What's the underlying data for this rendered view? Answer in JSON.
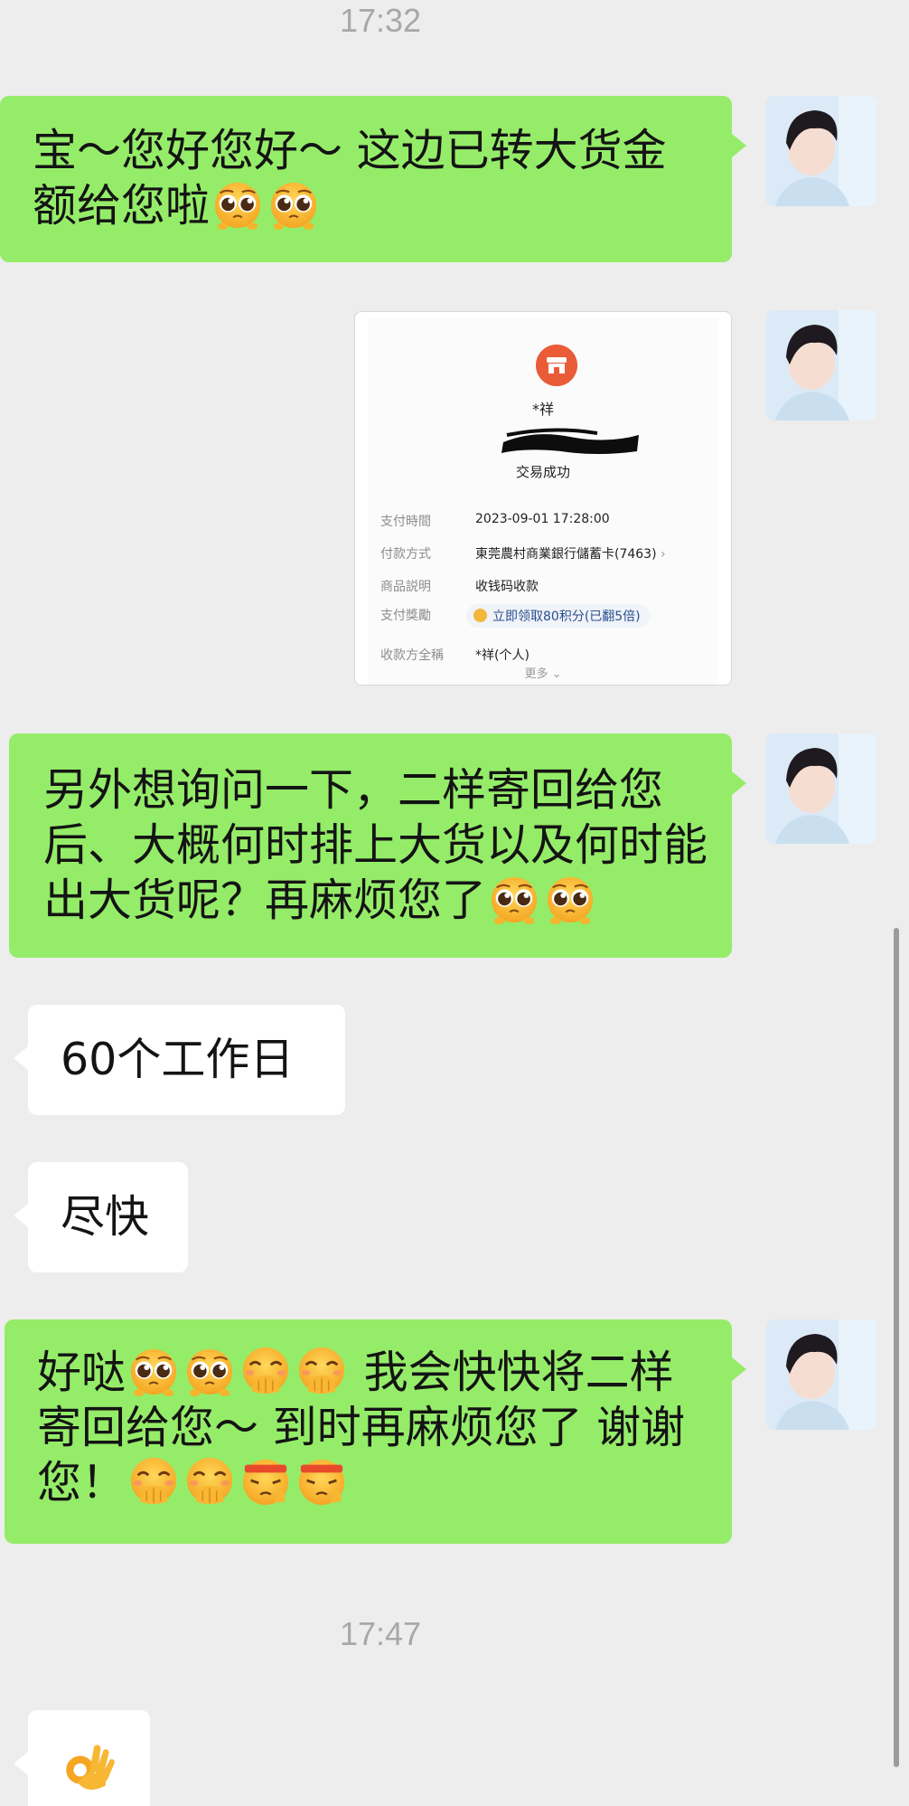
{
  "chat": {
    "timestamp_1": "17:32",
    "timestamp_2": "17:47",
    "messages": {
      "m1_text": "宝～您好您好～ 这边已转大货金额给您啦",
      "m3_text": "另外想询问一下，二样寄回给您后、大概何时排上大货以及何时能出大货呢？再麻烦您了",
      "m4_text": "60个工作日",
      "m5_text": "尽快",
      "m6_a": "好哒",
      "m6_b": " 我会快快将二样寄回给您～ 到时再麻烦您了 谢谢您！",
      "m7_emoji": "ok-hand-emoji"
    }
  },
  "payment_receipt": {
    "payee_short": "*祥",
    "status": "交易成功",
    "rows": [
      {
        "key": "支付時間",
        "value": "2023-09-01 17:28:00"
      },
      {
        "key": "付款方式",
        "value": "東莞農村商業銀行儲蓄卡(7463)"
      },
      {
        "key": "商品説明",
        "value": "收钱码收款"
      },
      {
        "key": "支付獎勵",
        "value": "立即领取80积分(已翻5倍)"
      },
      {
        "key": "收款方全稱",
        "value": "*祥(个人)"
      }
    ],
    "more_label": "更多"
  },
  "colors": {
    "background": "#ededed",
    "sent_bubble": "#95ec69",
    "received_bubble": "#ffffff",
    "timestamp": "#a8a8a8",
    "payment_logo": "#ea5b38"
  },
  "icons": {
    "pleading_face": "pleading-face-icon",
    "hand_over_mouth": "face-with-hand-over-mouth-icon",
    "saluting_face": "saluting-face-icon",
    "ok_hand": "ok-hand-icon",
    "store": "store-icon"
  }
}
